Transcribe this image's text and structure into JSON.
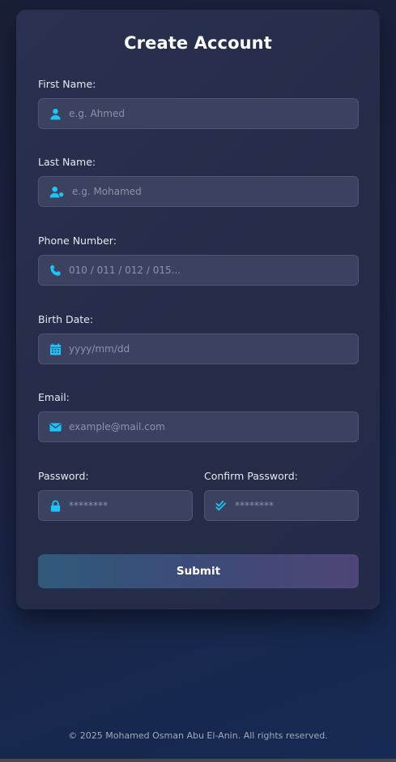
{
  "form": {
    "title": "Create Account",
    "first_name": {
      "label": "First Name:",
      "placeholder": "e.g. Ahmed",
      "icon": "user-icon"
    },
    "last_name": {
      "label": "Last Name:",
      "placeholder": "e.g. Mohamed",
      "icon": "user-tag-icon"
    },
    "phone": {
      "label": "Phone Number:",
      "placeholder": "010 / 011 / 012 / 015...",
      "icon": "phone-icon"
    },
    "birth_date": {
      "label": "Birth Date:",
      "placeholder": "yyyy/mm/dd",
      "icon": "calendar-icon"
    },
    "email": {
      "label": "Email:",
      "placeholder": "example@mail.com",
      "icon": "envelope-icon"
    },
    "password": {
      "label": "Password:",
      "placeholder": "********",
      "icon": "lock-icon"
    },
    "confirm_password": {
      "label": "Confirm Password:",
      "placeholder": "********",
      "icon": "double-check-icon"
    },
    "submit_label": "Submit"
  },
  "footer": {
    "text": "© 2025 Mohamed Osman Abu El-Anin. All rights reserved."
  },
  "colors": {
    "accent": "#1fc3f5",
    "card": "#262d4a",
    "field": "#3a4260",
    "background": "#1b2444"
  }
}
